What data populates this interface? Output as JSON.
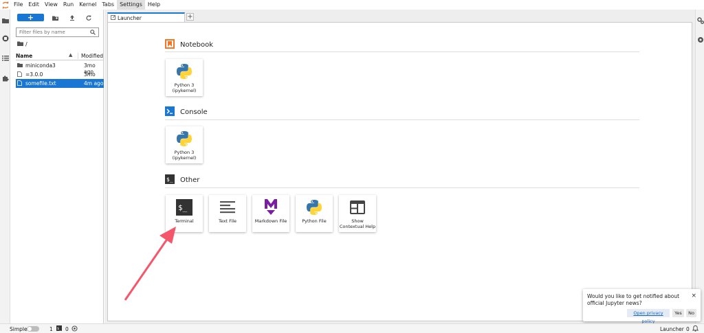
{
  "menubar": {
    "items": [
      "File",
      "Edit",
      "View",
      "Run",
      "Kernel",
      "Tabs",
      "Settings",
      "Help"
    ],
    "active_item": "Settings"
  },
  "filebrowser": {
    "new_button": "+",
    "filter_placeholder": "Filter files by name",
    "breadcrumb": "/",
    "columns": {
      "name": "Name",
      "modified": "Modified"
    },
    "files": [
      {
        "name": "miniconda3",
        "modified": "3mo ago",
        "type": "folder",
        "selected": false
      },
      {
        "name": "=3.0.0",
        "modified": "3mo ago",
        "type": "file",
        "selected": false
      },
      {
        "name": "somefile.txt",
        "modified": "4m ago",
        "type": "file",
        "selected": true
      }
    ]
  },
  "tabs": [
    {
      "label": "Launcher",
      "active": true
    }
  ],
  "launcher": {
    "sections": [
      {
        "title": "Notebook",
        "cards": [
          {
            "label": "Python 3 (ipykernel)",
            "icon": "python-icon"
          }
        ]
      },
      {
        "title": "Console",
        "cards": [
          {
            "label": "Python 3 (ipykernel)",
            "icon": "python-icon"
          }
        ]
      },
      {
        "title": "Other",
        "cards": [
          {
            "label": "Terminal",
            "icon": "terminal-icon"
          },
          {
            "label": "Text File",
            "icon": "text-file-icon"
          },
          {
            "label": "Markdown File",
            "icon": "markdown-icon"
          },
          {
            "label": "Python File",
            "icon": "python-icon"
          },
          {
            "label": "Show Contextual Help",
            "icon": "contextual-help-icon"
          }
        ]
      }
    ]
  },
  "notification": {
    "message": "Would you like to get notified about official Jupyter news?",
    "link": "Open privacy policy",
    "yes": "Yes",
    "no": "No",
    "close": "×"
  },
  "statusbar": {
    "mode": "Simple",
    "kernels": "1",
    "terminals": "0",
    "current": "Launcher",
    "notifications": "0"
  },
  "colors": {
    "accent": "#1976d2",
    "notebook": "#f37726",
    "console": "#1976d2",
    "markdown": "#7b1fa2",
    "annotation_arrow": "#f4566a"
  }
}
